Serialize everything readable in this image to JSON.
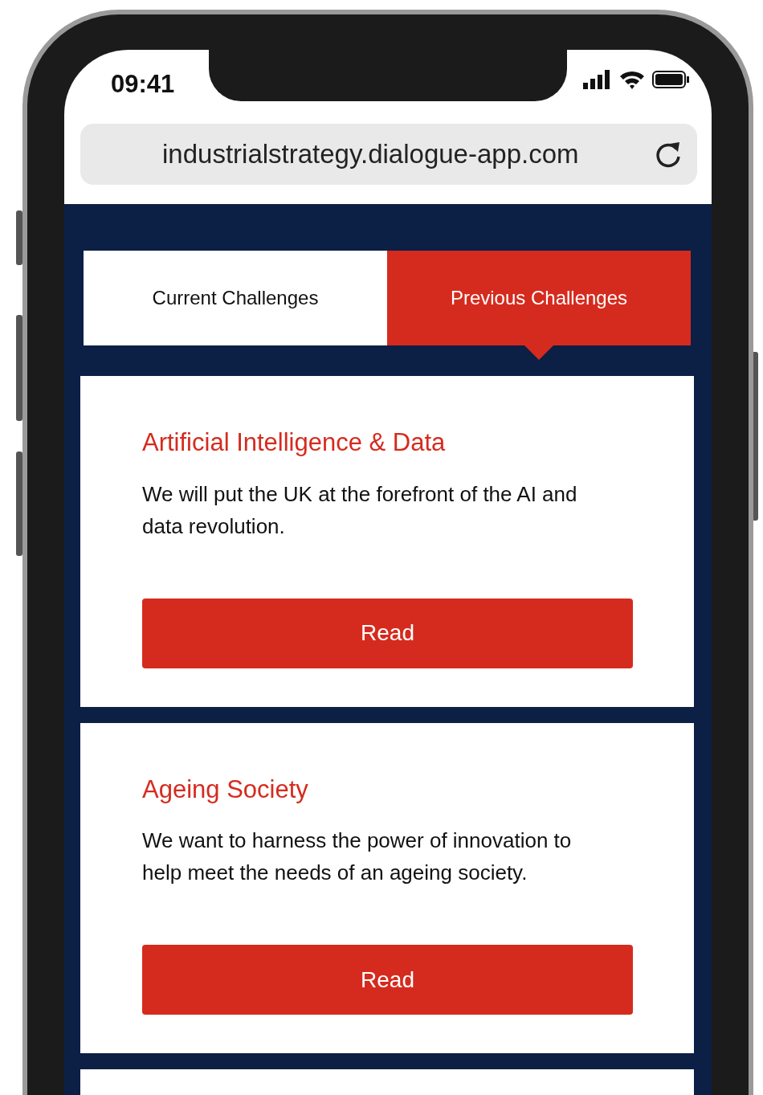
{
  "status_bar": {
    "time": "09:41"
  },
  "address_bar": {
    "url": "industrialstrategy.dialogue-app.com"
  },
  "tabs": [
    {
      "label": "Current Challenges",
      "selected": false
    },
    {
      "label": "Previous Challenges",
      "selected": true
    }
  ],
  "challenges": [
    {
      "title": "Artificial Intelligence & Data",
      "description": "We will put the UK at the forefront of the AI and data revolution.",
      "button": "Read"
    },
    {
      "title": "Ageing Society",
      "description": "We want to harness the power of innovation to help meet the needs of an ageing society.",
      "button": "Read"
    }
  ]
}
